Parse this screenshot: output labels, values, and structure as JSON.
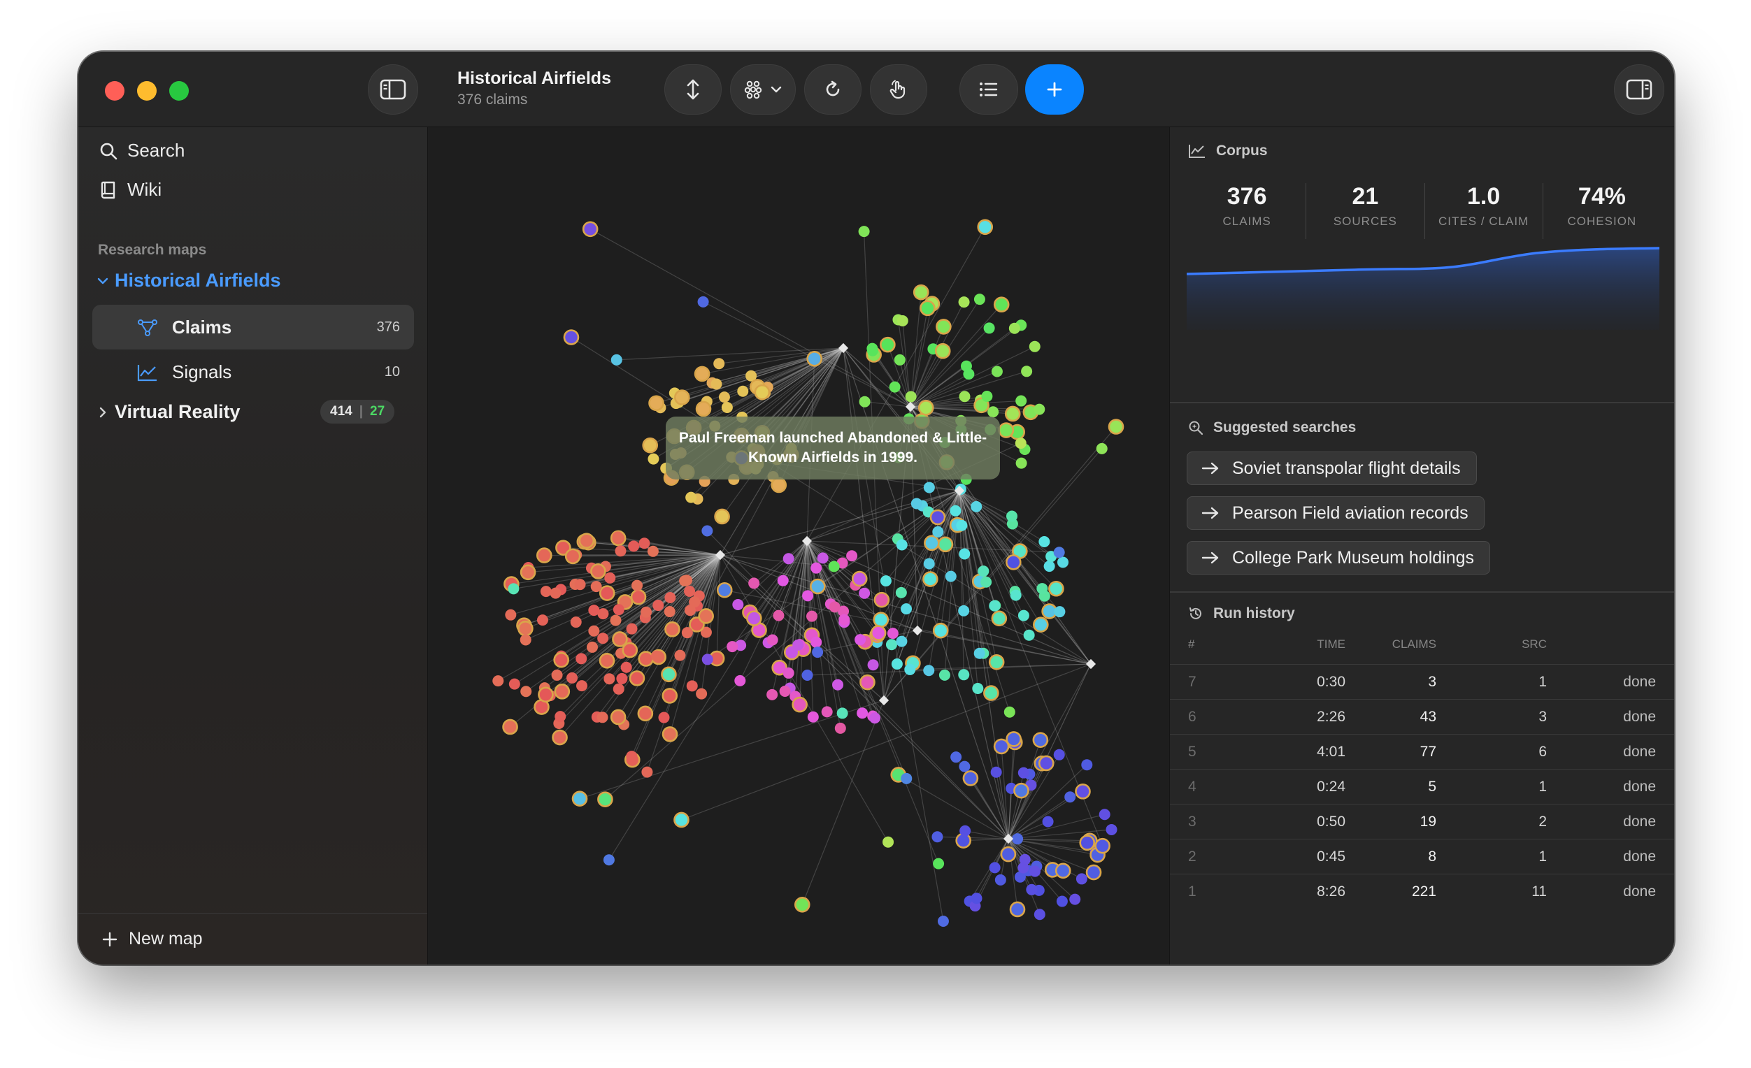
{
  "window": {
    "title": "Historical Airfields",
    "subtitle": "376 claims"
  },
  "toolbar": {
    "buttons": [
      "sidebar-toggle-icon",
      "vertical-arrows-icon",
      "graph-layout-icon",
      "refresh-icon",
      "hand-pointer-icon",
      "list-icon",
      "plus-icon",
      "inspector-toggle-icon"
    ]
  },
  "sidebar": {
    "search_label": "Search",
    "wiki_label": "Wiki",
    "section_label": "Research maps",
    "maps": [
      {
        "name": "Historical Airfields",
        "expanded": true,
        "children": [
          {
            "label": "Claims",
            "count": "376",
            "selected": true
          },
          {
            "label": "Signals",
            "count": "10",
            "selected": false
          }
        ]
      },
      {
        "name": "Virtual Reality",
        "expanded": false,
        "count_a": "414",
        "count_sep": "|",
        "count_b": "27"
      }
    ],
    "new_map_label": "New map"
  },
  "graph": {
    "tooltip": "Paul Freeman launched Abandoned & Little-Known Airfields in 1999."
  },
  "panel": {
    "corpus_title": "Corpus",
    "stats": [
      {
        "value": "376",
        "label": "CLAIMS"
      },
      {
        "value": "21",
        "label": "SOURCES"
      },
      {
        "value": "1.0",
        "label": "CITES / CLAIM"
      },
      {
        "value": "74%",
        "label": "COHESION"
      }
    ],
    "suggestions_title": "Suggested searches",
    "suggestions": [
      "Soviet transpolar flight details",
      "Pearson Field aviation records",
      "College Park Museum holdings"
    ],
    "history_title": "Run history",
    "history_columns": {
      "num": "#",
      "time": "TIME",
      "claims": "CLAIMS",
      "src": "SRC"
    },
    "history": [
      {
        "num": "7",
        "time": "0:30",
        "claims": "3",
        "src": "1",
        "status": "done"
      },
      {
        "num": "6",
        "time": "2:26",
        "claims": "43",
        "src": "3",
        "status": "done"
      },
      {
        "num": "5",
        "time": "4:01",
        "claims": "77",
        "src": "6",
        "status": "done"
      },
      {
        "num": "4",
        "time": "0:24",
        "claims": "5",
        "src": "1",
        "status": "done"
      },
      {
        "num": "3",
        "time": "0:50",
        "claims": "19",
        "src": "2",
        "status": "done"
      },
      {
        "num": "2",
        "time": "0:45",
        "claims": "8",
        "src": "1",
        "status": "done"
      },
      {
        "num": "1",
        "time": "8:26",
        "claims": "221",
        "src": "11",
        "status": "done"
      }
    ]
  },
  "colors": {
    "accent": "#0a84ff",
    "link": "#4a9bff",
    "success": "#4cd964",
    "traffic_close": "#ff5f57",
    "traffic_min": "#febc2e",
    "traffic_max": "#28c840"
  }
}
